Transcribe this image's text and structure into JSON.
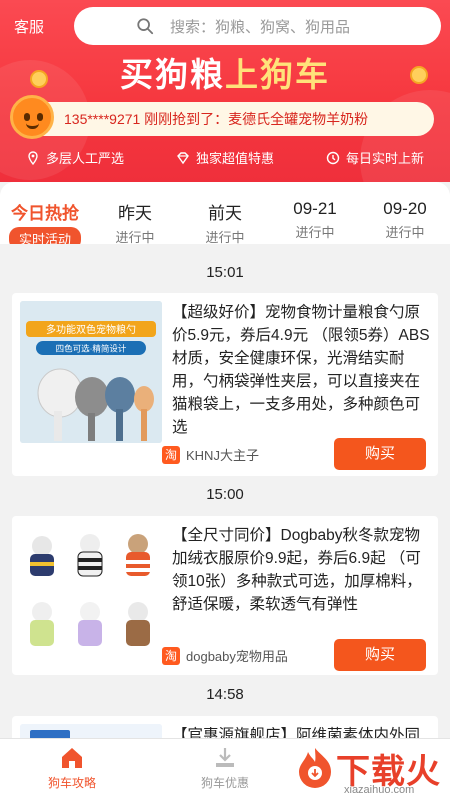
{
  "header": {
    "kefu_label": "客服",
    "search_placeholder": "搜索：狗粮、狗窝、狗用品",
    "banner_part1": "买狗粮",
    "banner_part2": "上狗车",
    "ticker_text": "135****9271 刚刚抢到了：麦德氏全罐宠物羊奶粉",
    "features": [
      "多层人工严选",
      "独家超值特惠",
      "每日实时上新"
    ]
  },
  "tabs": [
    {
      "label": "今日热抢",
      "sub": "实时活动",
      "active": true
    },
    {
      "label": "昨天",
      "sub": "进行中",
      "active": false
    },
    {
      "label": "前天",
      "sub": "进行中",
      "active": false
    },
    {
      "label": "09-21",
      "sub": "进行中",
      "active": false
    },
    {
      "label": "09-20",
      "sub": "进行中",
      "active": false
    }
  ],
  "feed": [
    {
      "time": "15:01",
      "desc": "【超级好价】宠物食物计量粮食勺原价5.9元，券后4.9元 （限领5券）ABS材质，安全健康环保，光滑结实耐用，勺柄袋弹性夹层，可以直接夹在猫粮袋上，一支多用处，多种颜色可选",
      "thumb_top_text": "多功能双色宠物粮勺",
      "thumb_sub_text": "四色可选·精简设计",
      "shop_icon": "淘",
      "shop": "KHNJ大主子",
      "buy_label": "购买"
    },
    {
      "time": "15:00",
      "desc": "【全尺寸同价】Dogbaby秋冬款宠物加绒衣服原价9.9起，券后6.9起 （可领10张）多种款式可选，加厚棉料，舒适保暖，柔软透气有弹性",
      "shop_icon": "淘",
      "shop": "dogbaby宠物用品",
      "buy_label": "购买"
    },
    {
      "time": "14:58",
      "desc": "【官惠源旗舰店】阿维菌素体内外同"
    }
  ],
  "bottomnav": {
    "items": [
      {
        "label": "狗车攻略",
        "active": true
      },
      {
        "label": "狗车优惠",
        "active": false
      }
    ]
  },
  "watermark": {
    "text": "下载火",
    "sub": "xiazaihuo.com"
  },
  "colors": {
    "primary_red": "#f6383f",
    "accent_orange": "#f4561d",
    "highlight_yellow": "#ffe27a"
  }
}
